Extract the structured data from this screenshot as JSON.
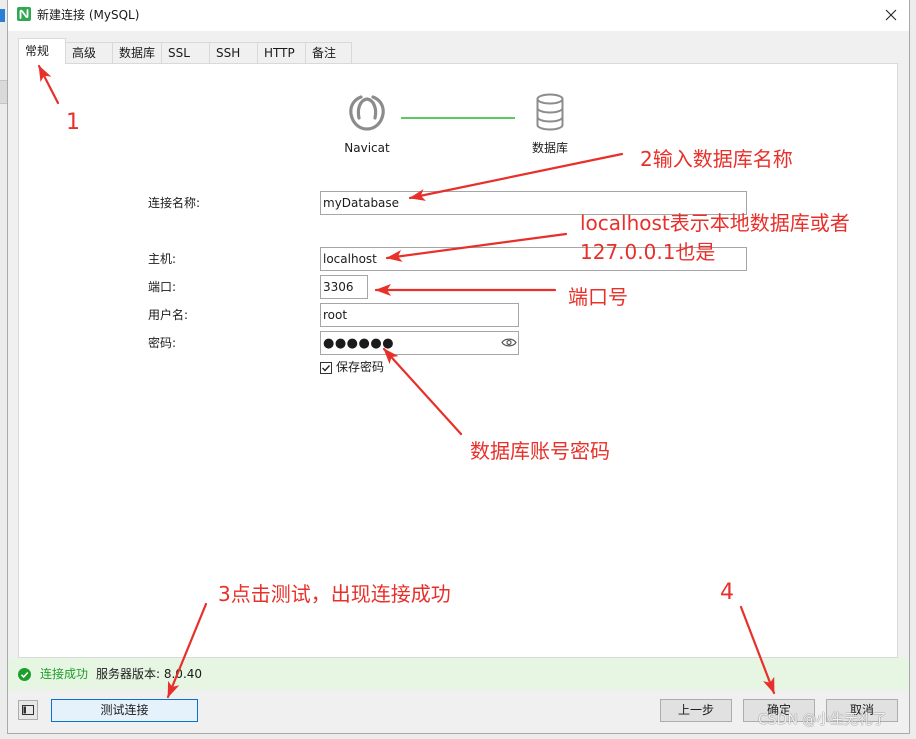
{
  "window": {
    "title": "新建连接 (MySQL)",
    "app_icon": "navicat-app-icon",
    "close_icon": "close-icon"
  },
  "tabs": [
    {
      "label": "常规",
      "active": true
    },
    {
      "label": "高级",
      "active": false
    },
    {
      "label": "数据库",
      "active": false
    },
    {
      "label": "SSL",
      "active": false
    },
    {
      "label": "SSH",
      "active": false
    },
    {
      "label": "HTTP",
      "active": false
    },
    {
      "label": "备注",
      "active": false
    }
  ],
  "diagram": {
    "client_label": "Navicat",
    "client_icon": "navicat-logo-icon",
    "server_label": "数据库",
    "server_icon": "database-icon"
  },
  "form": {
    "connection_name": {
      "label": "连接名称:",
      "value": "myDatabase"
    },
    "host": {
      "label": "主机:",
      "value": "localhost"
    },
    "port": {
      "label": "端口:",
      "value": "3306"
    },
    "username": {
      "label": "用户名:",
      "value": "root"
    },
    "password": {
      "label": "密码:",
      "value": "●●●●●●",
      "reveal_icon": "eye-icon"
    },
    "save_password": {
      "label": "保存密码",
      "checked": true
    }
  },
  "status": {
    "icon": "success-check-icon",
    "message": "连接成功",
    "server_version": "服务器版本: 8.0.40"
  },
  "footer": {
    "toggle_icon": "sidebar-panel-icon",
    "test_connection": "测试连接",
    "back": "上一步",
    "ok": "确定",
    "cancel": "取消"
  },
  "annotations": {
    "step1": "1",
    "step2": "2输入数据库名称",
    "host_note_line1": "localhost表示本地数据库或者",
    "host_note_line2": "127.0.0.1也是",
    "port_note": "端口号",
    "credentials_note": "数据库账号密码",
    "step3": "3点击测试，出现连接成功",
    "step4": "4"
  },
  "watermark": "CSDN @小生无礼了",
  "colors": {
    "annotation": "#e8302a",
    "status_text": "#1e9e2c",
    "status_background": "#e6f6e2",
    "link_line": "#5cc860",
    "focus_border": "#0a72c9",
    "app_icon": "#2fa84f"
  }
}
